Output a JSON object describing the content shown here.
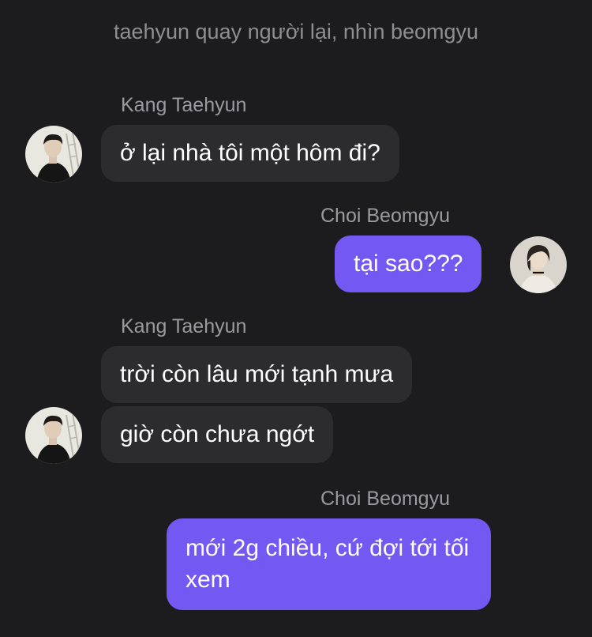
{
  "narration": "taehyun quay người lại, nhìn beomgyu",
  "messages": [
    {
      "sender": "Kang Taehyun",
      "side": "incoming",
      "bubbles": [
        "ở lại nhà tôi một hôm đi?"
      ]
    },
    {
      "sender": "Choi Beomgyu",
      "side": "outgoing",
      "bubbles": [
        "tại sao???"
      ]
    },
    {
      "sender": "Kang Taehyun",
      "side": "incoming",
      "bubbles": [
        "trời còn lâu mới tạnh mưa",
        "giờ còn chưa ngớt"
      ]
    },
    {
      "sender": "Choi Beomgyu",
      "side": "outgoing",
      "bubbles": [
        "mới 2g chiều, cứ đợi tới tối xem"
      ]
    }
  ],
  "avatars": {
    "taehyun": "taehyun-avatar",
    "beomgyu": "beomgyu-avatar"
  },
  "colors": {
    "background": "#1c1c1e",
    "incoming_bubble": "#2c2c2e",
    "outgoing_bubble": "#7359f2",
    "name_text": "#9a9aa0",
    "narration_text": "#8e8e93"
  }
}
